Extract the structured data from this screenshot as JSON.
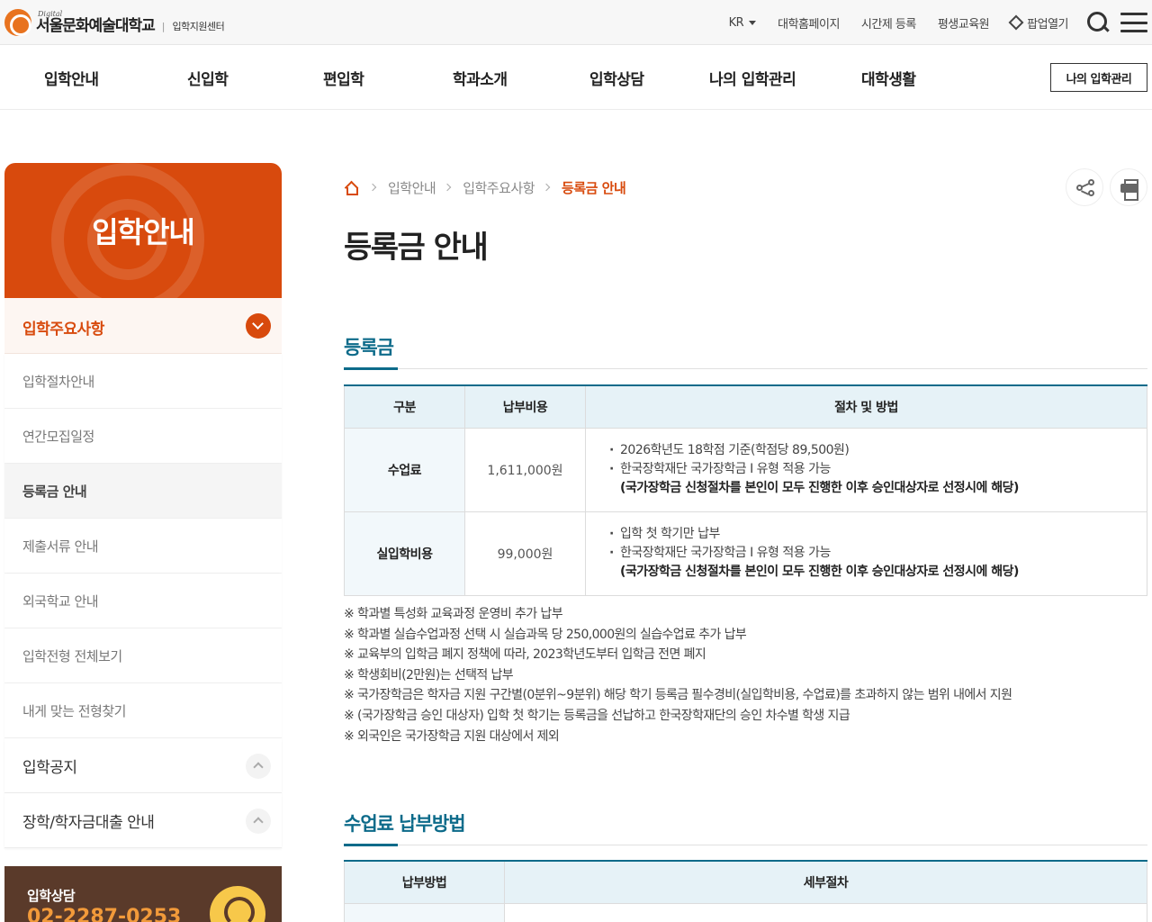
{
  "header": {
    "logo_sub": "Digital",
    "logo_main": "서울문화예술대학교",
    "logo_divider": "|",
    "logo_center": "입학지원센터",
    "utils": [
      "KR",
      "대학홈페이지",
      "시간제 등록",
      "평생교육원",
      "팝업열기"
    ]
  },
  "nav": {
    "items": [
      "입학안내",
      "신입학",
      "편입학",
      "학과소개",
      "입학상담",
      "나의 입학관리",
      "대학생활"
    ],
    "button": "나의 입학관리"
  },
  "sidebar": {
    "title": "입학안내",
    "active_group": "입학주요사항",
    "sub_items": [
      "입학절차안내",
      "연간모집일정",
      "등록금 안내",
      "제출서류 안내",
      "외국학교 안내",
      "입학전형 전체보기",
      "내게 맞는 전형찾기"
    ],
    "current_index": 2,
    "groups": [
      "입학공지",
      "장학/학자금대출 안내"
    ],
    "consult_label": "입학상담",
    "consult_phone": "02-2287-0253"
  },
  "breadcrumb": [
    "입학안내",
    "입학주요사항",
    "등록금 안내"
  ],
  "page_title": "등록금 안내",
  "section1": {
    "title": "등록금",
    "headers": [
      "구분",
      "납부비용",
      "절차 및 방법"
    ],
    "rows": [
      {
        "label": "수업료",
        "amount": "1,611,000원",
        "bullets": [
          "2026학년도 18학점 기준(학점당 89,500원)",
          "한국장학재단 국가장학금 Ⅰ 유형 적용 가능"
        ],
        "strong": "(국가장학금 신청절차를 본인이 모두 진행한 이후 승인대상자로 선정시에 해당)"
      },
      {
        "label": "실입학비용",
        "amount": "99,000원",
        "bullets": [
          "입학 첫 학기만 납부",
          "한국장학재단 국가장학금 Ⅰ 유형 적용 가능"
        ],
        "strong": "(국가장학금 신청절차를 본인이 모두 진행한 이후 승인대상자로 선정시에 해당)"
      }
    ],
    "notes": [
      "※ 학과별 특성화 교육과정 운영비 추가 납부",
      "※ 학과별 실습수업과정 선택 시 실습과목 당 250,000원의 실습수업료 추가 납부",
      "※ 교육부의 입학금 폐지 정책에 따라, 2023학년도부터 입학금 전면 폐지",
      "※ 학생회비(2만원)는 선택적 납부",
      "※ 국가장학금은 학자금 지원 구간별(0분위~9분위) 해당 학기 등록금 필수경비(실입학비용, 수업료)를 초과하지 않는 범위 내에서 지원",
      "※ (국가장학금 승인 대상자) 입학 첫 학기는 등록금을 선납하고 한국장학재단의 승인 차수별 학생 지급",
      "※ 외국인은 국가장학금 지원 대상에서 제외"
    ]
  },
  "section2": {
    "title": "수업료 납부방법",
    "headers": [
      "납부방법",
      "세부절차"
    ]
  },
  "colors": {
    "brand_orange": "#d84a0d",
    "accent_teal": "#0d6b8a",
    "table_header": "#e6f2f7"
  }
}
